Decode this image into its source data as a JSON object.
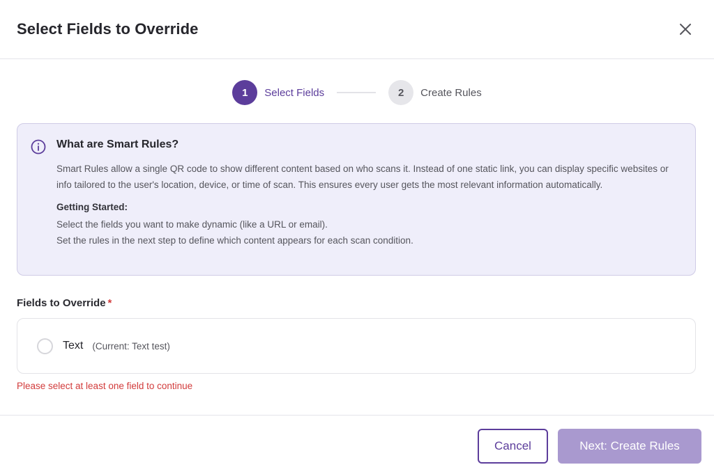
{
  "dialog": {
    "title": "Select Fields to Override",
    "close_icon": "close-icon"
  },
  "stepper": {
    "steps": [
      {
        "number": "1",
        "label": "Select Fields",
        "active": true
      },
      {
        "number": "2",
        "label": "Create Rules",
        "active": false
      }
    ]
  },
  "info": {
    "icon": "info-icon",
    "title": "What are Smart Rules?",
    "description": "Smart Rules allow a single QR code to show different content based on who scans it. Instead of one static link, you can display specific websites or info tailored to the user's location, device, or time of scan. This ensures every user gets the most relevant information automatically.",
    "getting_started_title": "Getting Started:",
    "steps": [
      "Select the fields you want to make dynamic (like a URL or email).",
      "Set the rules in the next step to define which content appears for each scan condition."
    ]
  },
  "fields": {
    "label": "Fields to Override",
    "required_mark": "*",
    "items": [
      {
        "name": "Text",
        "current": "(Current: Text test)",
        "checked": false
      }
    ],
    "error": "Please select at least one field to continue"
  },
  "footer": {
    "cancel_label": "Cancel",
    "next_label": "Next: Create Rules"
  },
  "colors": {
    "accent": "#5c3d9b",
    "accent_disabled": "#a999cf",
    "info_bg": "#efeefa",
    "error": "#d23b3b"
  }
}
